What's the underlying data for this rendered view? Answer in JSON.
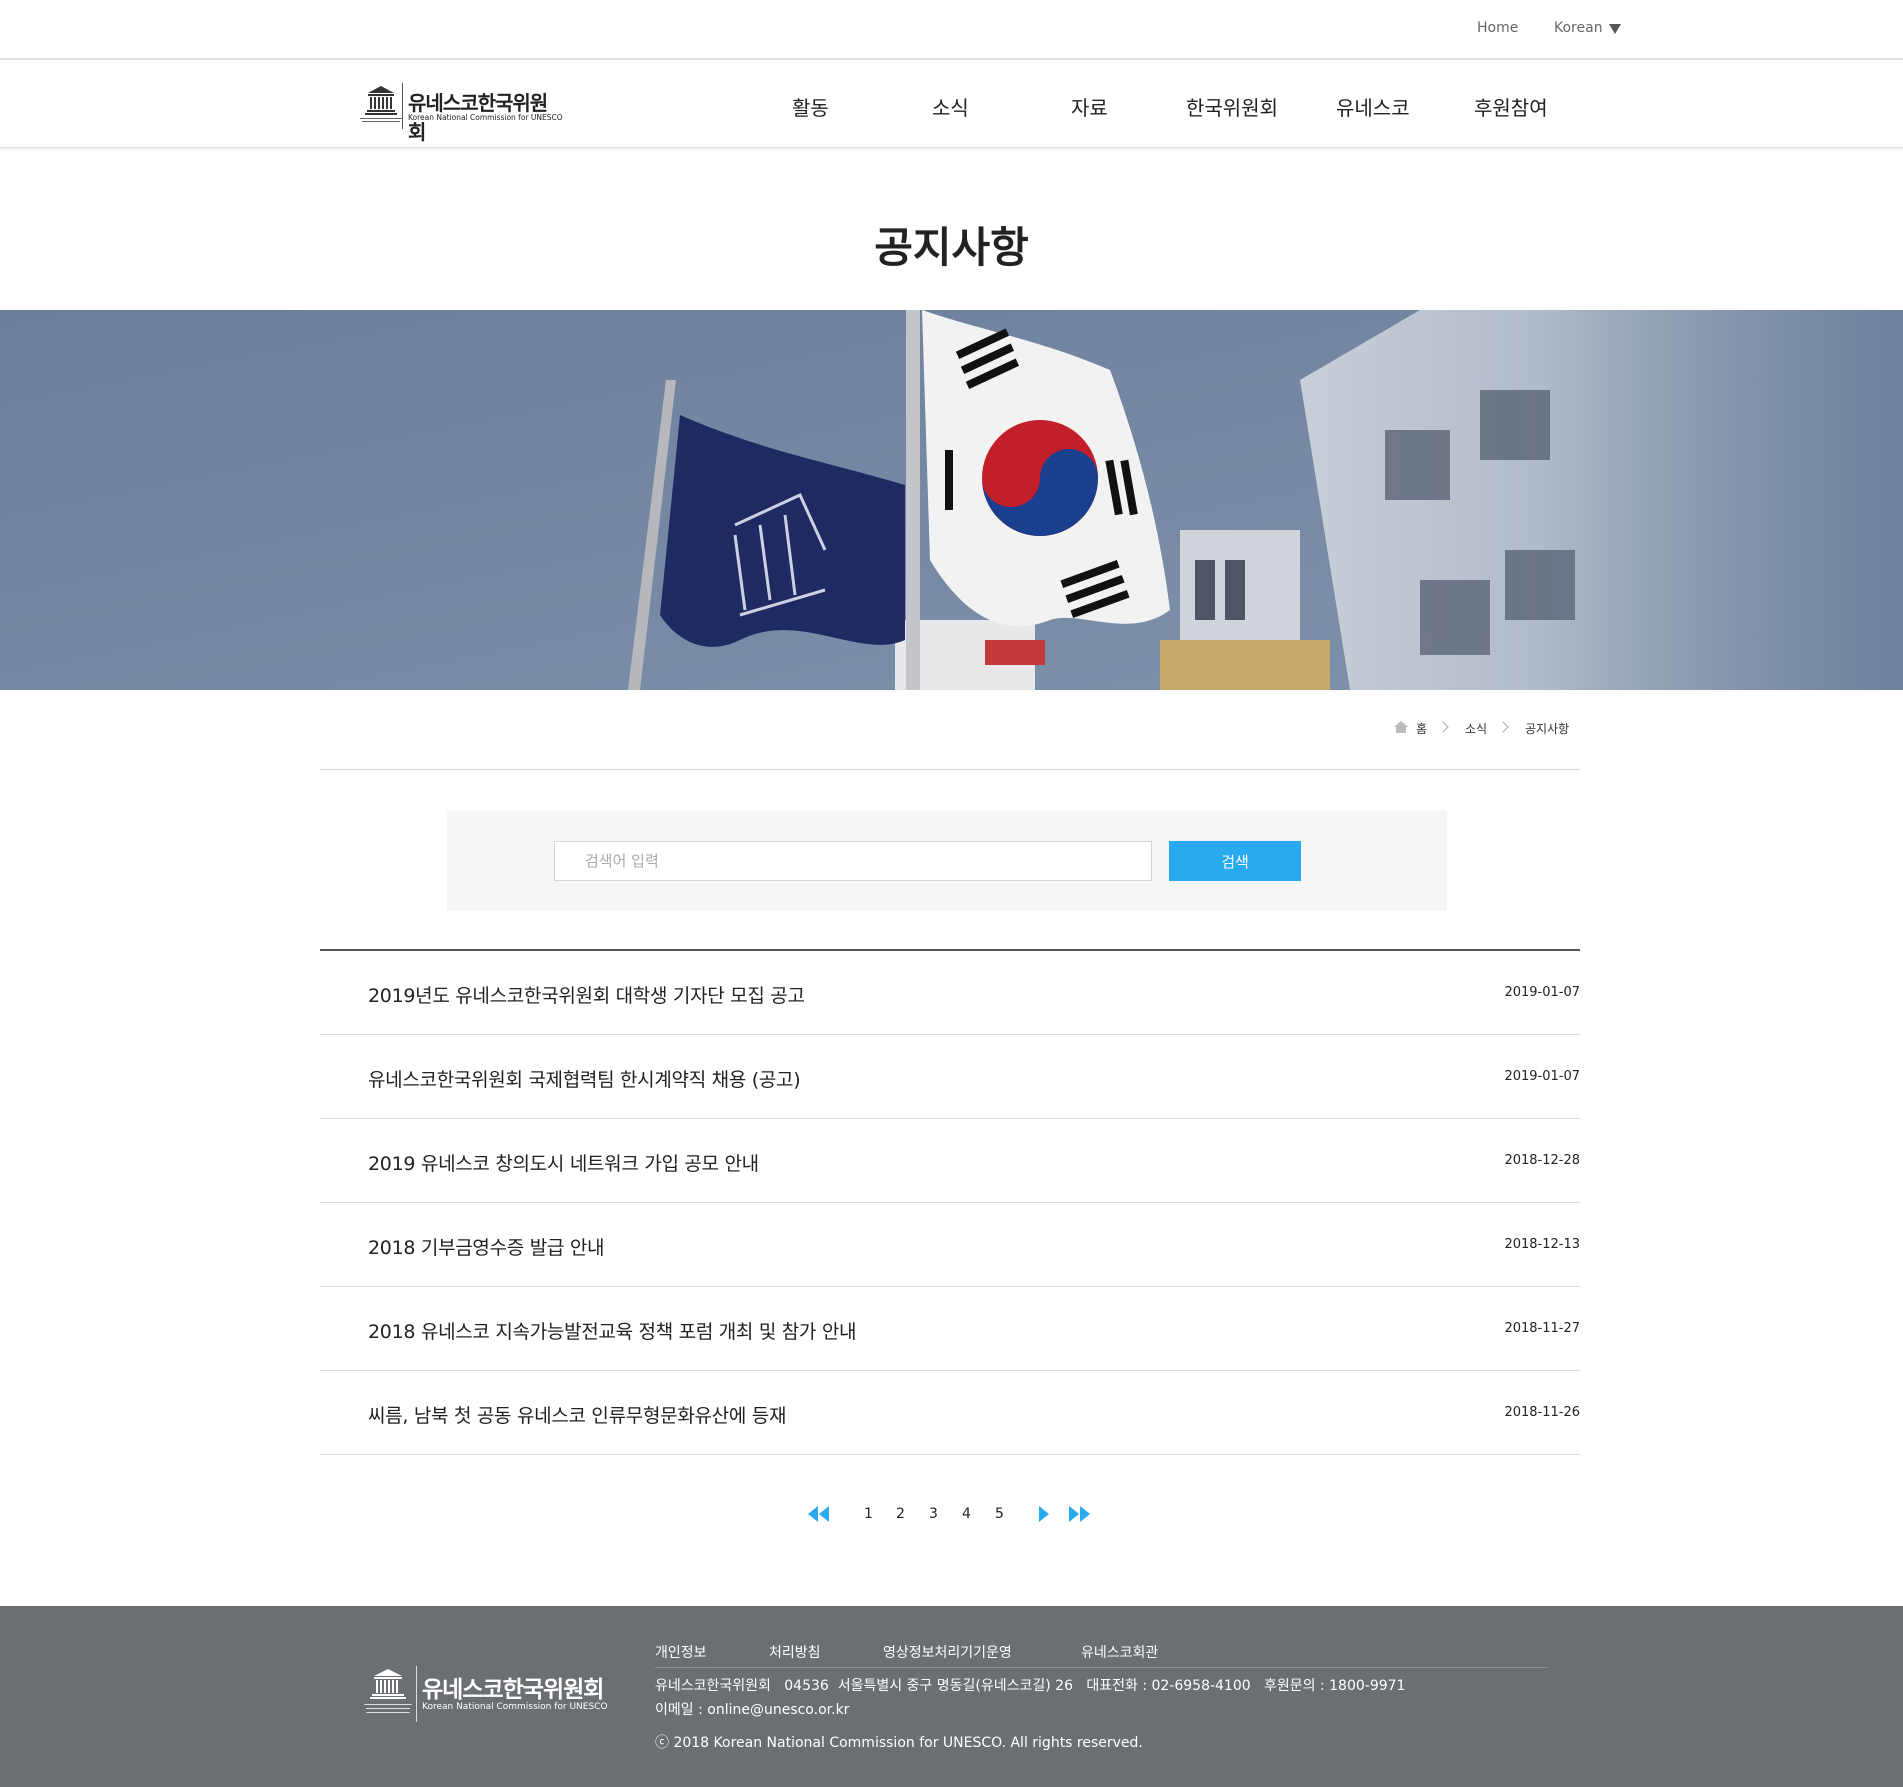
{
  "utility": {
    "home_label": "Home",
    "language_label": "Korean"
  },
  "logo": {
    "korean_name": "유네스코한국위원회",
    "english_name": "Korean National Commission for UNESCO"
  },
  "nav": {
    "items": [
      {
        "label": "활동"
      },
      {
        "label": "소식"
      },
      {
        "label": "자료"
      },
      {
        "label": "한국위원회"
      },
      {
        "label": "유네스코"
      },
      {
        "label": "후원참여"
      }
    ]
  },
  "page_title": "공지사항",
  "breadcrumb": {
    "home": "홈",
    "section": "소식",
    "current": "공지사항"
  },
  "search": {
    "placeholder": "검색어 입력",
    "value": "",
    "button_label": "검색"
  },
  "notices": [
    {
      "title": "2019년도 유네스코한국위원회 대학생 기자단 모집 공고",
      "date": "2019-01-07"
    },
    {
      "title": "유네스코한국위원회 국제협력팀 한시계약직 채용 (공고)",
      "date": "2019-01-07"
    },
    {
      "title": "2019 유네스코 창의도시 네트워크 가입 공모 안내",
      "date": "2018-12-28"
    },
    {
      "title": "2018 기부금영수증 발급 안내",
      "date": "2018-12-13"
    },
    {
      "title": "2018 유네스코 지속가능발전교육 정책 포럼 개최 및 참가 안내",
      "date": "2018-11-27"
    },
    {
      "title": "씨름, 남북 첫 공동 유네스코 인류무형문화유산에 등재",
      "date": "2018-11-26"
    }
  ],
  "pagination": {
    "pages": [
      "1",
      "2",
      "3",
      "4",
      "5"
    ],
    "icons": [
      "first-page-icon",
      "next-page-icon",
      "last-page-icon"
    ],
    "accent_color": "#29aaf0"
  },
  "footer": {
    "links": [
      {
        "label": "개인정보"
      },
      {
        "label": "처리방침"
      },
      {
        "label": "영상정보처리기기운영"
      },
      {
        "label": "유네스코회관"
      }
    ],
    "address_line": "유네스코한국위원회   04536  서울특별시 중구 명동길(유네스코길) 26   대표전화 : 02-6958-4100   후원문의 : 1800-9971",
    "email_line": "이메일 : online@unesco.or.kr",
    "copyright": "ⓒ 2018 Korean National Commission for UNESCO. All rights reserved."
  },
  "colors": {
    "accent": "#29aaf0",
    "footer_bg": "#6b6e73",
    "search_bg": "#f5f6f8"
  }
}
